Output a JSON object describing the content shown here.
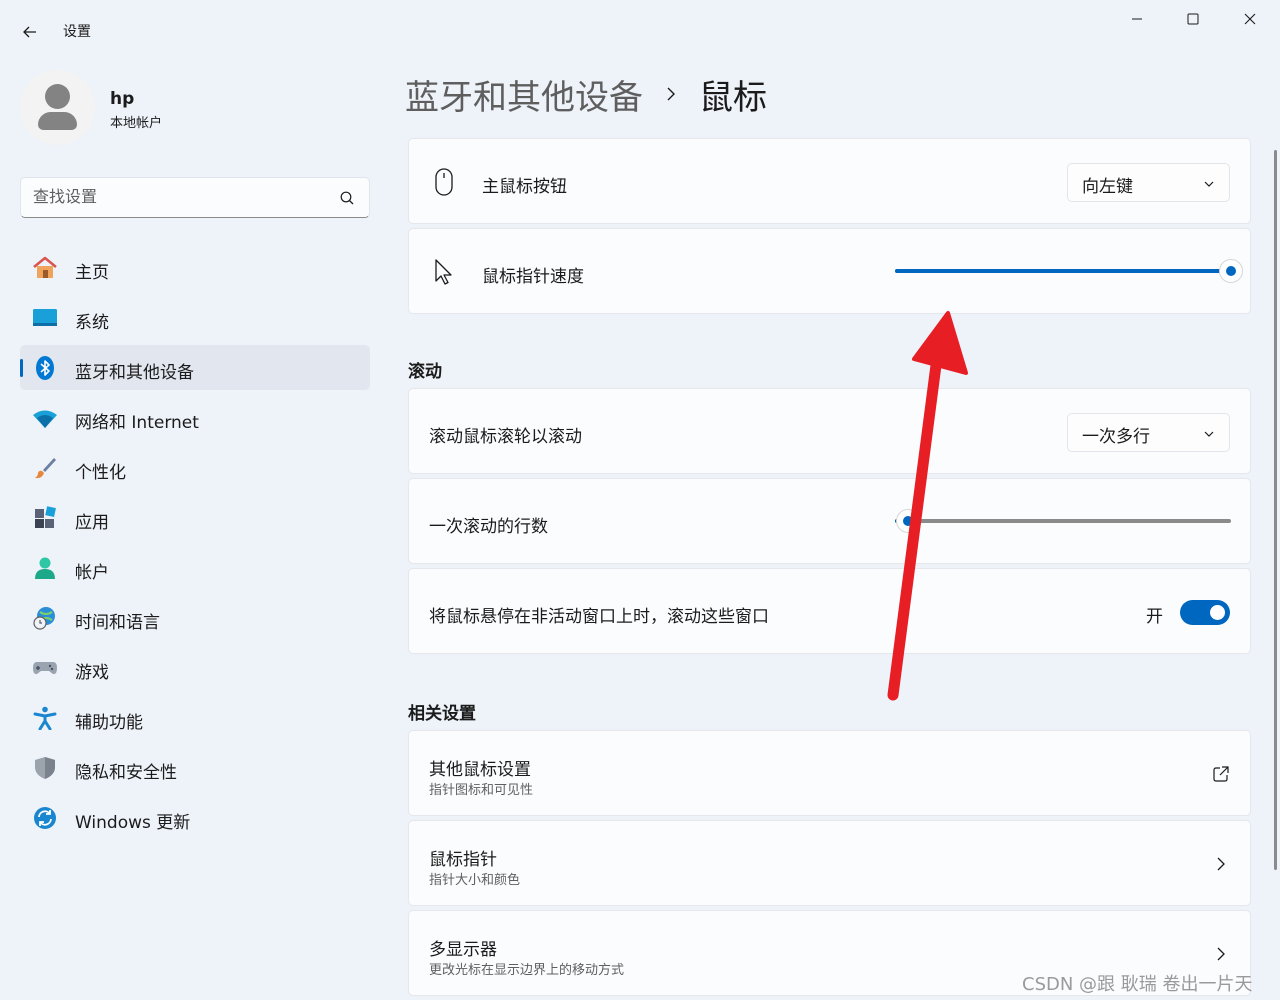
{
  "window": {
    "title": "设置"
  },
  "profile": {
    "name": "hp",
    "account_type": "本地帐户"
  },
  "search": {
    "placeholder": "查找设置"
  },
  "sidebar": {
    "items": [
      {
        "label": "主页",
        "icon": "home-icon",
        "active": false
      },
      {
        "label": "系统",
        "icon": "system-icon",
        "active": false
      },
      {
        "label": "蓝牙和其他设备",
        "icon": "bluetooth-icon",
        "active": true
      },
      {
        "label": "网络和 Internet",
        "icon": "wifi-icon",
        "active": false
      },
      {
        "label": "个性化",
        "icon": "brush-icon",
        "active": false
      },
      {
        "label": "应用",
        "icon": "apps-icon",
        "active": false
      },
      {
        "label": "帐户",
        "icon": "account-icon",
        "active": false
      },
      {
        "label": "时间和语言",
        "icon": "time-language-icon",
        "active": false
      },
      {
        "label": "游戏",
        "icon": "gamepad-icon",
        "active": false
      },
      {
        "label": "辅助功能",
        "icon": "accessibility-icon",
        "active": false
      },
      {
        "label": "隐私和安全性",
        "icon": "shield-icon",
        "active": false
      },
      {
        "label": "Windows 更新",
        "icon": "update-icon",
        "active": false
      }
    ]
  },
  "breadcrumb": {
    "parent": "蓝牙和其他设备",
    "current": "鼠标"
  },
  "mouse": {
    "primary_button": {
      "label": "主鼠标按钮",
      "value": "向左键"
    },
    "pointer_speed": {
      "label": "鼠标指针速度",
      "value_fraction": 1.0
    }
  },
  "scrolling": {
    "heading": "滚动",
    "scroll_wheel": {
      "label": "滚动鼠标滚轮以滚动",
      "value": "一次多行"
    },
    "lines_per_scroll": {
      "label": "一次滚动的行数",
      "value_fraction": 0.04
    },
    "inactive_scroll": {
      "label": "将鼠标悬停在非活动窗口上时，滚动这些窗口",
      "state_label": "开",
      "on": true
    }
  },
  "related": {
    "heading": "相关设置",
    "items": [
      {
        "title": "其他鼠标设置",
        "subtitle": "指针图标和可见性",
        "icon": "external-link-icon"
      },
      {
        "title": "鼠标指针",
        "subtitle": "指针大小和颜色",
        "icon": "chevron-right-icon"
      },
      {
        "title": "多显示器",
        "subtitle": "更改光标在显示边界上的移动方式",
        "icon": "chevron-right-icon"
      }
    ]
  },
  "watermark": "CSDN @跟 耿瑞 卷出一片天",
  "colors": {
    "accent": "#0067c0",
    "annotation_arrow": "#e81e25",
    "background": "#eef2f9",
    "card": "#fbfcfe"
  }
}
